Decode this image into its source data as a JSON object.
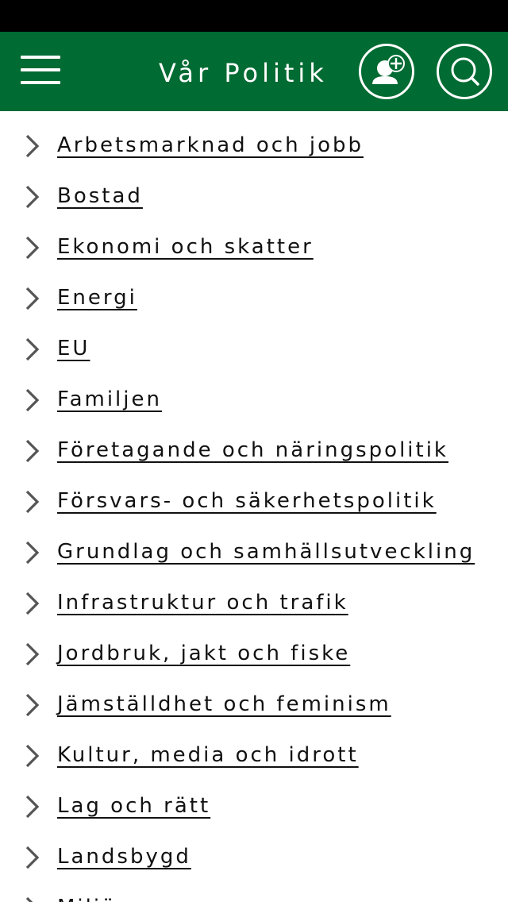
{
  "header": {
    "title": "Vår Politik",
    "add_icon": "user-plus-icon",
    "search_icon": "search-icon",
    "menu_icon": "hamburger-menu-icon"
  },
  "colors": {
    "header_bg": "#006b32",
    "status_bar_bg": "#000000",
    "text": "#111111",
    "chevron": "#555555"
  },
  "topics": [
    {
      "label": "Arbetsmarknad och jobb"
    },
    {
      "label": "Bostad"
    },
    {
      "label": "Ekonomi och skatter"
    },
    {
      "label": "Energi"
    },
    {
      "label": "EU"
    },
    {
      "label": "Familjen"
    },
    {
      "label": "Företagande och näringspolitik"
    },
    {
      "label": "Försvars- och säkerhetspolitik"
    },
    {
      "label": "Grundlag och samhällsutveckling"
    },
    {
      "label": "Infrastruktur och trafik"
    },
    {
      "label": "Jordbruk, jakt och fiske"
    },
    {
      "label": "Jämställdhet och feminism"
    },
    {
      "label": "Kultur, media och idrott"
    },
    {
      "label": "Lag och rätt"
    },
    {
      "label": "Landsbygd"
    },
    {
      "label": "Miljö"
    }
  ]
}
